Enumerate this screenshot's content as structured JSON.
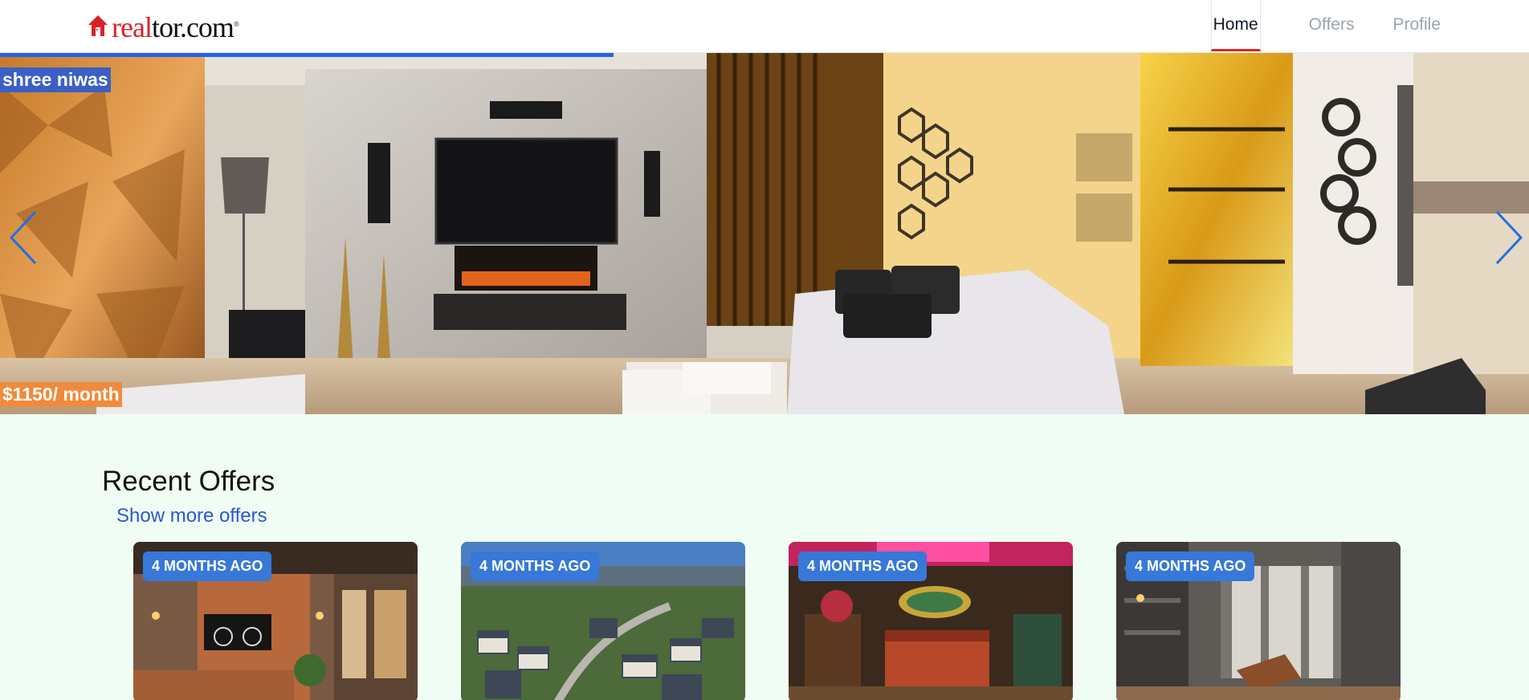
{
  "header": {
    "logo": {
      "real": "real",
      "tor": "tor.com",
      "reg": "®"
    },
    "nav": [
      "Home",
      "Offers",
      "Profile"
    ]
  },
  "hero": {
    "title": "shree niwas",
    "price": "$1150/ month",
    "prev_icon": "chevron-left-icon",
    "next_icon": "chevron-right-icon"
  },
  "offers": {
    "title": "Recent Offers",
    "show_more": "Show more offers",
    "cards": [
      {
        "badge": "4 MONTHS AGO"
      },
      {
        "badge": "4 MONTHS AGO"
      },
      {
        "badge": "4 MONTHS AGO"
      },
      {
        "badge": "4 MONTHS AGO"
      }
    ]
  },
  "colors": {
    "brand_red": "#d92228",
    "accent_blue": "#2563eb",
    "badge_blue": "#3778d8",
    "price_orange": "#f08a3c",
    "page_bg": "#f0fdf4"
  }
}
